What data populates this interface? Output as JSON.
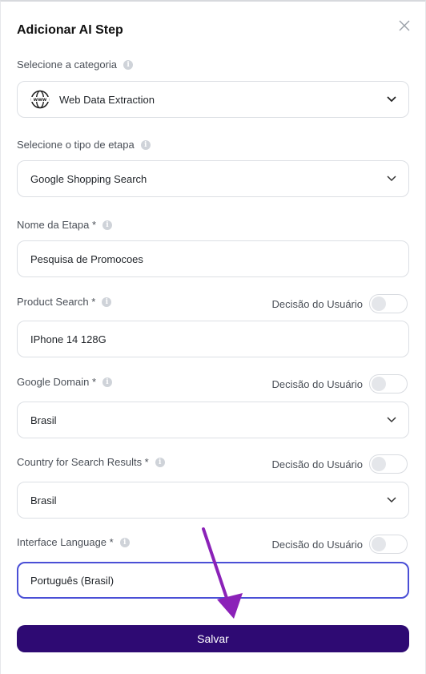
{
  "modal": {
    "title": "Adicionar AI Step",
    "close_icon": "close-icon"
  },
  "category": {
    "label": "Selecione a categoria",
    "value": "Web Data Extraction",
    "icon": "globe-www-icon"
  },
  "step_type": {
    "label": "Selecione o tipo de etapa",
    "value": "Google Shopping Search"
  },
  "step_name": {
    "label": "Nome da Etapa *",
    "value": "Pesquisa de Promocoes"
  },
  "product_search": {
    "label": "Product Search *",
    "toggle_label": "Decisão do Usuário",
    "toggle_on": false,
    "value": "IPhone 14 128G"
  },
  "google_domain": {
    "label": "Google Domain *",
    "toggle_label": "Decisão do Usuário",
    "toggle_on": false,
    "value": "Brasil"
  },
  "country": {
    "label": "Country for Search Results *",
    "toggle_label": "Decisão do Usuário",
    "toggle_on": false,
    "value": "Brasil"
  },
  "interface_language": {
    "label": "Interface Language *",
    "toggle_label": "Decisão do Usuário",
    "toggle_on": false,
    "value": "Português (Brasil)"
  },
  "save_label": "Salvar",
  "colors": {
    "primary": "#2e0a73",
    "focus_border": "#4a4fd6",
    "annotation_arrow": "#8b22b8"
  }
}
